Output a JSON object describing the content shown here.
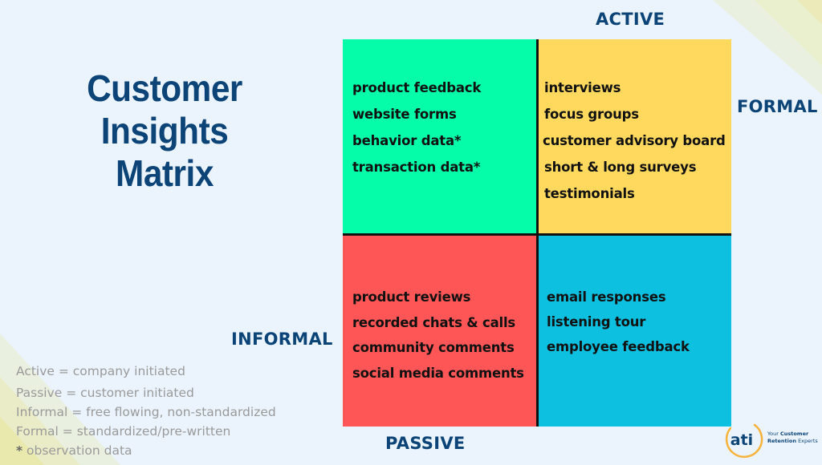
{
  "title": {
    "lines": [
      "Customer",
      "Insights",
      "Matrix"
    ]
  },
  "axes": {
    "top": "ACTIVE",
    "bottom": "PASSIVE",
    "left": "INFORMAL",
    "right": "FORMAL"
  },
  "quadrants": {
    "active_informal": {
      "color": "#05fdaa",
      "items": [
        "product feedback",
        "website forms",
        "behavior data*",
        "transaction data*"
      ]
    },
    "active_formal": {
      "color": "#fed95e",
      "items": [
        "interviews",
        "focus groups",
        "customer advisory board",
        "short & long surveys",
        "testimonials"
      ]
    },
    "passive_informal": {
      "color": "#fe5656",
      "items": [
        "product reviews",
        "recorded chats & calls",
        "community comments",
        "social media comments"
      ]
    },
    "passive_formal": {
      "color": "#0dc0e0",
      "items": [
        "email responses",
        "listening tour",
        "employee feedback"
      ]
    }
  },
  "legend": {
    "active": "Active = company initiated",
    "passive": "Passive = customer initiated",
    "informal": "Informal = free flowing, non-standardized",
    "formal": "Formal = standardized/pre-written",
    "star": "*",
    "observation": " observation data"
  },
  "logo": {
    "mark": "ati",
    "tagline_1_plain": "Your ",
    "tagline_1_bold": "Customer",
    "tagline_2_bold": "Retention",
    "tagline_2_plain": " Experts"
  },
  "colors": {
    "brand_navy": "#0c4478",
    "logo_orange": "#f7b33c",
    "background": "#ebf4fd"
  }
}
